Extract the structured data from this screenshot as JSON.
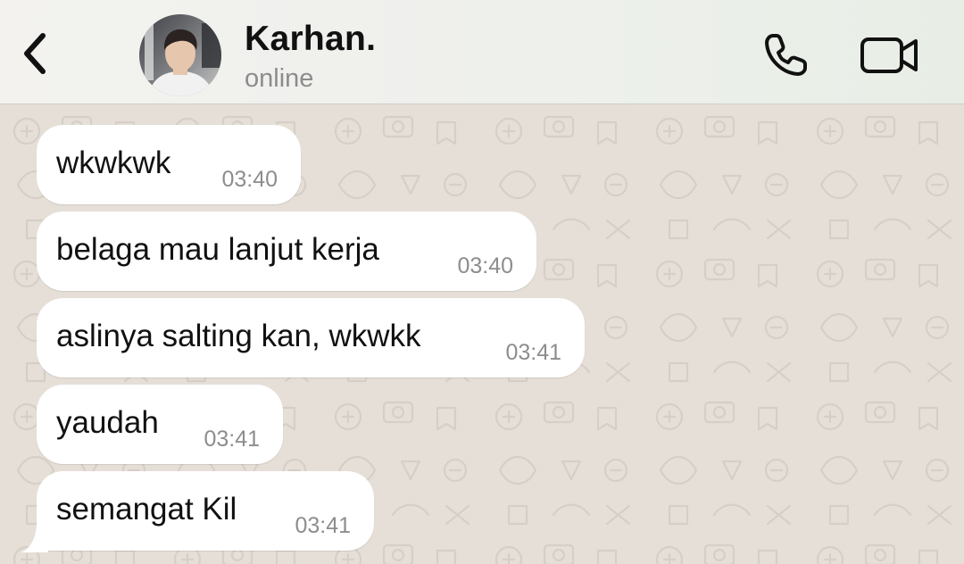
{
  "header": {
    "contact_name": "Karhan.",
    "status": "online",
    "back_icon": "chevron-left-icon",
    "call_icon": "phone-icon",
    "video_icon": "video-camera-icon",
    "background_color": "#f0f1ee"
  },
  "chat": {
    "wallpaper_color": "#e5dfd8",
    "bubble_color": "#ffffff",
    "messages": [
      {
        "text": "wkwkwk",
        "time": "03:40"
      },
      {
        "text": "belaga mau lanjut kerja",
        "time": "03:40"
      },
      {
        "text": "aslinya salting kan, wkwkk",
        "time": "03:41"
      },
      {
        "text": "yaudah",
        "time": "03:41"
      },
      {
        "text": "semangat Kil",
        "time": "03:41"
      }
    ]
  }
}
